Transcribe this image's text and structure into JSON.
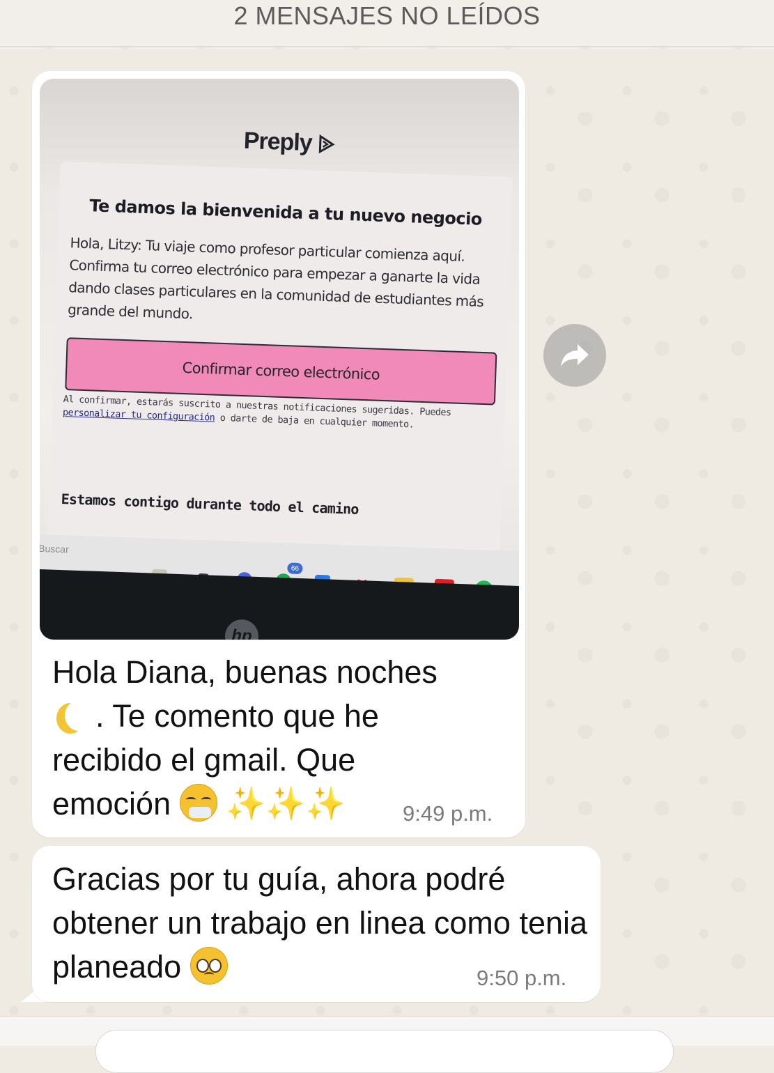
{
  "unread_banner": "2 MENSAJES NO LEÍDOS",
  "photo": {
    "logo": "Preply",
    "email_title": "Te damos la bienvenida a tu nuevo negocio",
    "email_body": "Hola, Litzy: Tu viaje como profesor particular comienza aquí. Confirma tu correo electrónico para empezar a ganarte la vida dando clases particulares en la comunidad de estudiantes más grande del mundo.",
    "confirm_button": "Confirmar correo electrónico",
    "fineprint_prefix": "Al confirmar, estarás suscrito a nuestras notificaciones sugeridas. Puedes ",
    "fineprint_link": "personalizar tu configuración",
    "fineprint_suffix": " o darte de baja en cualquier momento.",
    "footer_heading": "Estamos contigo durante todo el camino",
    "taskbar_search": "Buscar",
    "whatsapp_badge": "66",
    "hp_logo": "hp"
  },
  "messages": [
    {
      "text_part1": "Hola Diana, buenas noches",
      "text_part2": ". Te comento que he recibido el gmail. Que emoción",
      "emojis": [
        "crescent-moon",
        "sneezing-face",
        "sparkles",
        "sparkles",
        "sparkles"
      ],
      "time": "9:49 p.m."
    },
    {
      "text": "Gracias por tu guía, ahora podré obtener un trabajo en linea como tenia planeado",
      "emojis": [
        "pleading-face"
      ],
      "time": "9:50 p.m."
    }
  ],
  "colors": {
    "chat_background": "#efeae2",
    "bubble": "#ffffff",
    "preply_button": "#f18ab8"
  }
}
